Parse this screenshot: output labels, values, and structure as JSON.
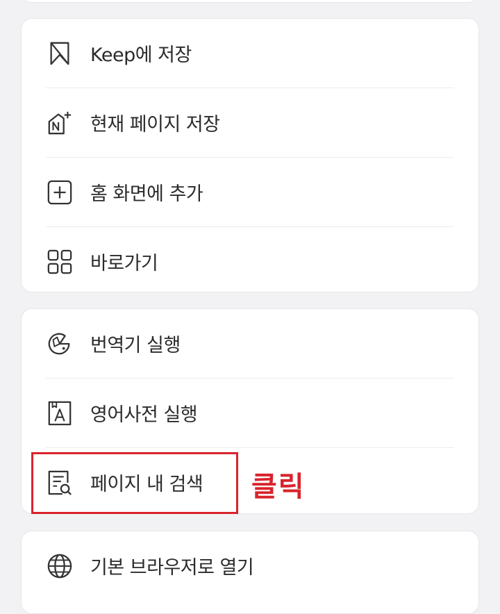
{
  "menu_group_1": [
    {
      "label": "Keep에 저장",
      "icon": "bookmark-icon"
    },
    {
      "label": "현재 페이지 저장",
      "icon": "save-page-icon"
    },
    {
      "label": "홈 화면에 추가",
      "icon": "add-square-icon"
    },
    {
      "label": "바로가기",
      "icon": "grid-icon"
    }
  ],
  "menu_group_2": [
    {
      "label": "번역기 실행",
      "icon": "translator-icon"
    },
    {
      "label": "영어사전 실행",
      "icon": "dictionary-icon"
    },
    {
      "label": "페이지 내 검색",
      "icon": "find-in-page-icon"
    }
  ],
  "menu_group_3": [
    {
      "label": "기본 브라우저로 열기",
      "icon": "globe-icon"
    }
  ],
  "annotation": {
    "text": "클릭",
    "color": "#d9232c"
  }
}
